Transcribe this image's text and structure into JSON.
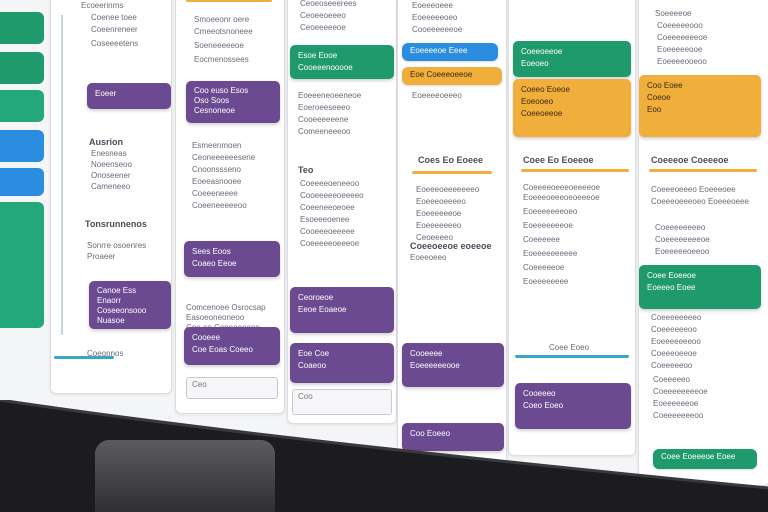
{
  "colors": {
    "purple": "#6b4a92",
    "green": "#1f9a6c",
    "blue": "#2a8de0",
    "amber": "#f0ae3a",
    "bezel": "#1c1c1f"
  },
  "col1": {
    "lines_top": [
      "Ecoeerinms",
      "Coenee toee",
      "Coeenreneer",
      "Coseeeetens"
    ],
    "card1": "Eoeer",
    "section": "Ausrion",
    "lines_mid": [
      "Enesneas",
      "Noeenseoo",
      "Onoseener",
      "Cameneeo"
    ],
    "section2": "Tonsrunnenos",
    "lines_low": [
      "Sonrre osoenres",
      "Proaeer"
    ],
    "card2": [
      "Canoe Ess",
      "Enaorr",
      "Coseeonsooo",
      "Nuasoe"
    ],
    "footer": "Coeonnos"
  },
  "col2": {
    "lines_top": [
      "Smoeeonr oere",
      "Cmeeotsnoneee",
      "Soeneeeeeoe",
      "Eocmenossees"
    ],
    "card1": [
      "Coo euso Esos",
      "Oso Soos",
      "Cesnoneoe"
    ],
    "lines_mid": [
      "Esmeenmoen",
      "Ceoneeeeeesene",
      "Cnoonssseno",
      "Eoeeasnooee",
      "Coeeeneeee",
      "Coeeneeeeeoo"
    ],
    "card2": [
      "Sees Eoos",
      "Coaeo Eeoe"
    ],
    "lines_low": [
      "Comcenoee Osrocsap",
      "Easoeoneoneoo",
      "Coe oe Coneaeeene"
    ],
    "card3": [
      "Cooeee",
      "Coe Eoas Coeeo"
    ],
    "input": "Ceo"
  },
  "col3": {
    "lines_top": [
      "Ceoeoseeerees",
      "Ceoeeoeeeo",
      "Ceoeeeeeoe"
    ],
    "card1": [
      "Esoe Eooe",
      "Cooeeenooooe"
    ],
    "lines_mid": [
      "Eoeeeneoeeneoe",
      "Eoeroeeseeeo",
      "Cooeeeeeene",
      "Comeeneeeoo"
    ],
    "section": "Teo",
    "lines_mid2": [
      "Coeeeeoeneeoo",
      "Cooeeeeeoeeeeo",
      "Coeeneeoeoee",
      "Esoeeeoenee",
      "Cooeeeoeeeee",
      "Coeeeeeoeeeoe"
    ],
    "card2": [
      "Ceoroeoe",
      "Eeoe Eoaeoe"
    ],
    "card3": [
      "Eoe Coe",
      "Coaeoo"
    ],
    "input": "Coo"
  },
  "col4": {
    "pill_blue": "Eoeeeeoe Eeee",
    "pill_amber": "Eoe Coeeeoeeoe",
    "lines_top": [
      "Eoeeeoeee",
      "Eoeeeeeoeo",
      "Cooeeeeeeoe",
      "Eoeeeeoeeeo"
    ],
    "section": "Coes Eo Eoeee",
    "lines_mid": [
      "Eoeeeoeeeeeeeo",
      "Eoeeeoeeeeo",
      "Eoeeeeeeoe",
      "Eoeeeeeeeo",
      "Ceoeeeeo"
    ],
    "section2": "Coeeoeeoe eoeeoe",
    "line2": "Eoeeoeeo",
    "card1": [
      "Cooeeee",
      "Eoeeeeeeooe"
    ],
    "card2": "Coo Eoeeo"
  },
  "col5": {
    "card_top": [
      "Coeeoeeoe",
      "Eoeoeo"
    ],
    "card_amber": [
      "Coeeo Eoeoe",
      "Eoeooeo",
      "Coeeoeeoe"
    ],
    "section": "Coee Eo Eoeeoe",
    "lines_mid": [
      "Coeeeeoeeeoeeeeoe",
      "Eoeeeoeeeoeoeeeoe",
      "Eoeeeeeeeoeo",
      "Eoeeeeeeeoe",
      "Coeeeeee",
      "Eoeeeeeeeeee",
      "Coeeeeeoe",
      "Eoeeeeeeee"
    ],
    "bar_label": "Coee Eoeo",
    "card1": [
      "Cooeeeo",
      "Coeo Eoeo"
    ]
  },
  "col6": {
    "lines_top": [
      "Soeeeeoe",
      "Coeeeeeooo",
      "Coeeeeeeeoe",
      "Eoeeeeeooe",
      "Eoeeeeooeoo"
    ],
    "card_amber": [
      "Coo Eoee",
      "Coeoe",
      "Eoo"
    ],
    "section": "Coeeeoe Coeeeoe",
    "lines_mid": [
      "Coeeeoeeeo Eoeeeoee",
      "Coeeeoeeeoeo Eoeeeoeee",
      "Coeeeeeeeeo",
      "Coeeeeeeeeoe",
      "Eoeeeeeoeeoo"
    ],
    "card_green": [
      "Coee Eoeeoe",
      "Eoeeeo Eoee"
    ],
    "lines_low": [
      "Coeeeeeeeeo",
      "Coeeeeeeoo",
      "Eoeeeeeeeoo",
      "Coeeeoeeoe",
      "Coeeeeeoo"
    ],
    "lines_low2": [
      "Coeeeeeo",
      "Coeeeeeeeeoe",
      "Eoeeeeeeoe",
      "Coeeeeeeeoo"
    ],
    "pill_green": "Coee Eoeeeoe Eoee"
  }
}
